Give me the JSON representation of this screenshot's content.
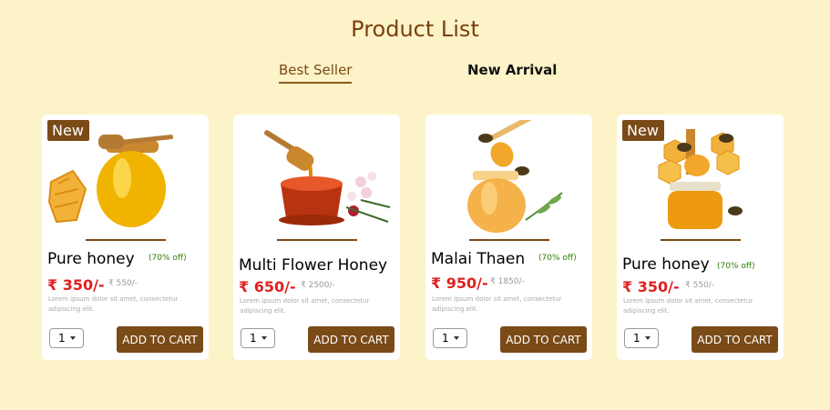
{
  "page": {
    "title": "Product List"
  },
  "tabs": [
    {
      "label": "Best Seller",
      "active": true
    },
    {
      "label": "New Arrival",
      "active": false
    }
  ],
  "products": [
    {
      "badge": "New",
      "name": "Pure honey",
      "discount": "(70% off)",
      "price": "₹ 350/-",
      "mrp": "₹ 550/-",
      "description": "Lorem ipsum dolor sit amet, consectetur adipiscing elit.",
      "quantity": "1",
      "button": "ADD TO CART"
    },
    {
      "badge": "",
      "name": "Multi Flower Honey",
      "discount": "",
      "price": "₹ 650/-",
      "mrp": "₹ 2500/-",
      "description": "Lorem ipsum dolor sit amet, consectetur adipiscing elit.",
      "quantity": "1",
      "button": "ADD TO CART"
    },
    {
      "badge": "",
      "name": "Malai Thaen",
      "discount": "(70% off)",
      "price": "₹ 950/-",
      "mrp": "₹ 1850/-",
      "description": "Lorem ipsum dolor sit amet, consectetur adipiscing elit.",
      "quantity": "1",
      "button": "ADD TO CART"
    },
    {
      "badge": "New",
      "name": "Pure honey",
      "discount": "(70% off)",
      "price": "₹ 350/-",
      "mrp": "₹ 550/-",
      "description": "Lorem ipsum dolor sit amet, consectetur adipiscing elit.",
      "quantity": "1",
      "button": "ADD TO CART"
    }
  ],
  "colors": {
    "background": "#fdf3c8",
    "brand": "#7a4a17",
    "price": "#e02020",
    "discount": "#2e7d00"
  },
  "icons": [
    "honey-jar-icon",
    "dropdown-caret-icon"
  ]
}
